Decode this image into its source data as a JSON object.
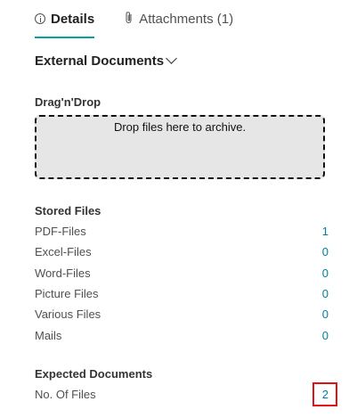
{
  "tabs": {
    "details": "Details",
    "attachments": "Attachments (1)"
  },
  "section": {
    "title": "External Documents"
  },
  "dragdrop": {
    "label": "Drag'n'Drop",
    "hint": "Drop files here to archive."
  },
  "stored": {
    "title": "Stored Files",
    "rows": [
      {
        "label": "PDF-Files",
        "value": "1"
      },
      {
        "label": "Excel-Files",
        "value": "0"
      },
      {
        "label": "Word-Files",
        "value": "0"
      },
      {
        "label": "Picture Files",
        "value": "0"
      },
      {
        "label": "Various Files",
        "value": "0"
      },
      {
        "label": "Mails",
        "value": "0"
      }
    ]
  },
  "expected": {
    "title": "Expected Documents",
    "rows": [
      {
        "label": "No. Of Files",
        "value": "2"
      }
    ]
  },
  "colors": {
    "accent": "#00a3a3",
    "link": "#00809e",
    "highlight": "#e31313"
  },
  "icons": {
    "details_tab": "info-icon",
    "attachments_tab": "paperclip-icon",
    "section_toggle": "chevron-down-icon"
  }
}
